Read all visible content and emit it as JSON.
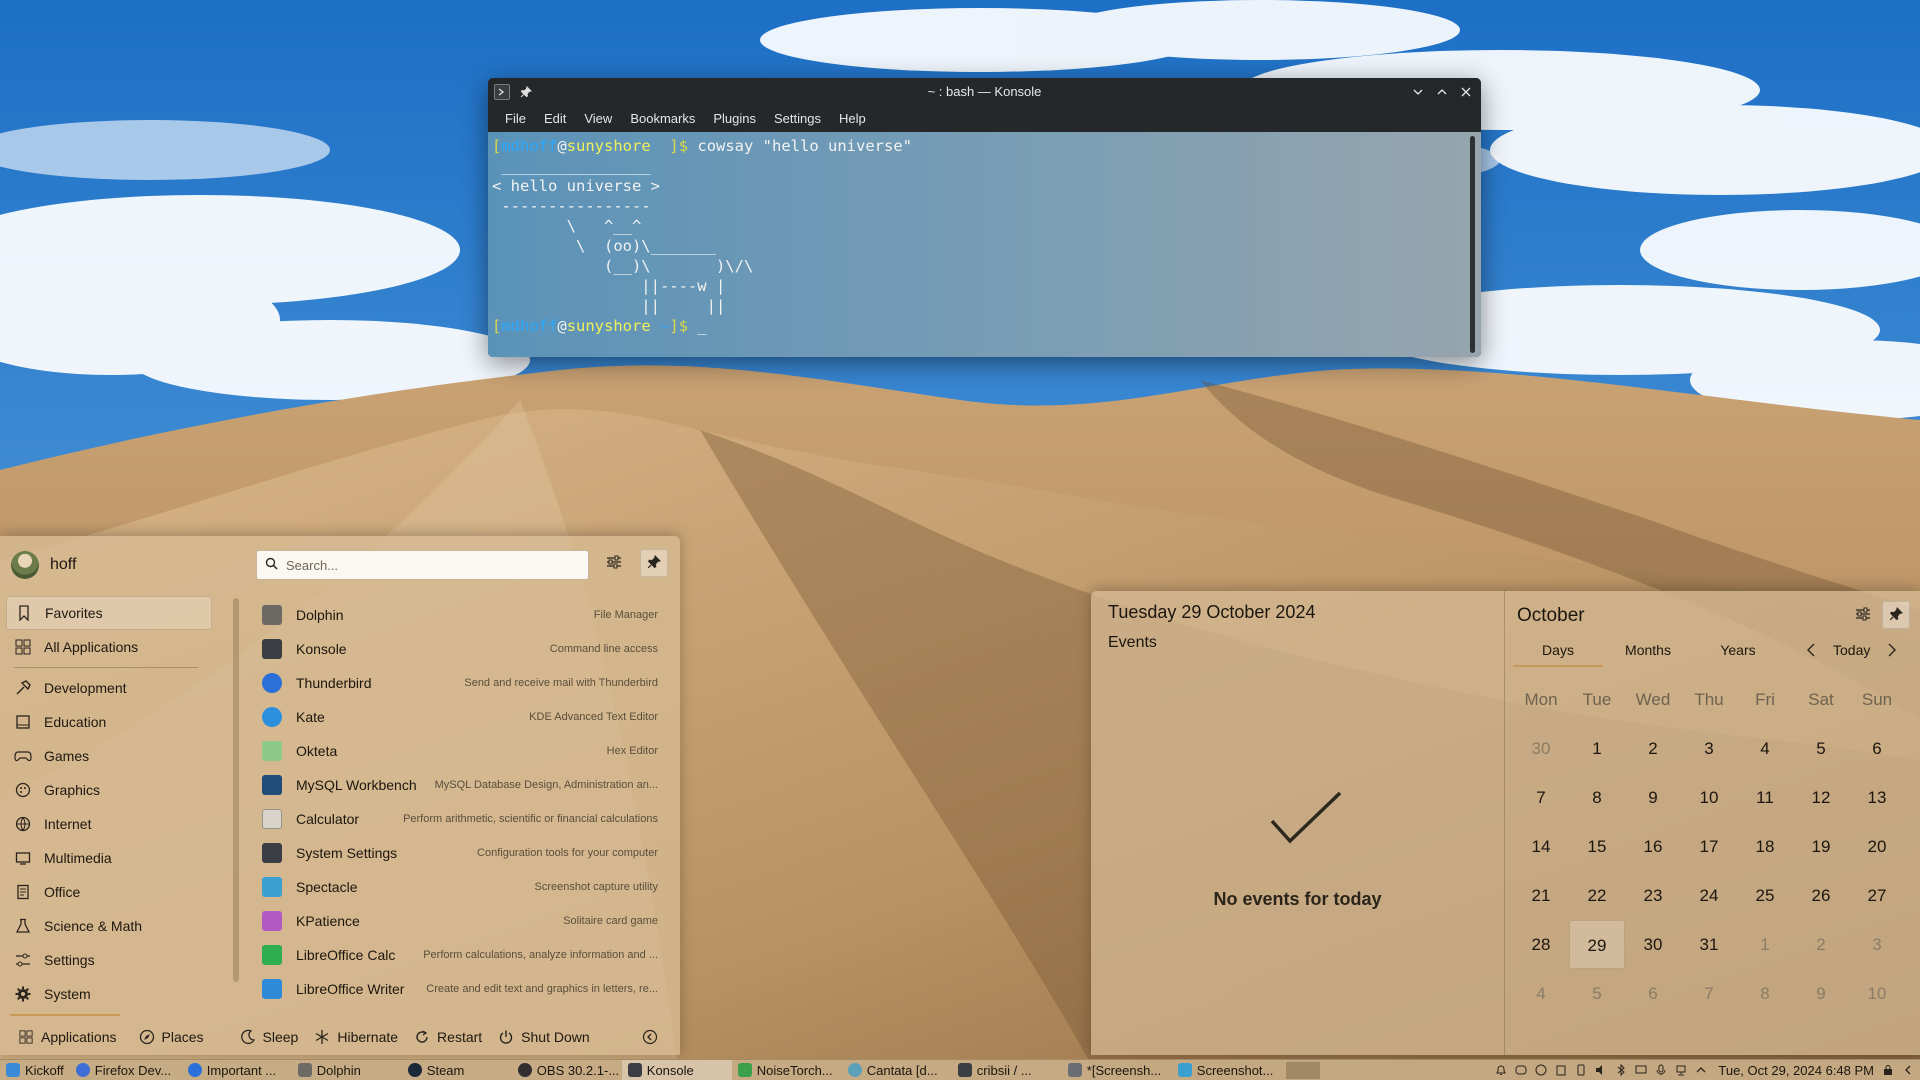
{
  "konsole": {
    "title": "~ : bash — Konsole",
    "menu": [
      "File",
      "Edit",
      "View",
      "Bookmarks",
      "Plugins",
      "Settings",
      "Help"
    ],
    "prompt1": {
      "user": "mdhoff",
      "host": "sunyshore",
      "path": " ",
      "command": "cowsay \"hello universe\""
    },
    "cowsay_output": " ________________\n< hello universe >\n ----------------\n        \\   ^__^\n         \\  (oo)\\_______\n            (__)\\       )\\/\\\n                ||----w |\n                ||     ||",
    "prompt2": {
      "user": "mdhoff",
      "host": "sunyshore",
      "path": "~",
      "cursor": "_"
    }
  },
  "kickoff": {
    "username": "hoff",
    "search_placeholder": "Search...",
    "categories": [
      {
        "label": "Favorites",
        "icon": "bookmark-icon"
      },
      {
        "label": "All Applications",
        "icon": "grid-icon"
      },
      {
        "label": "Development",
        "icon": "hammer-icon"
      },
      {
        "label": "Education",
        "icon": "education-icon"
      },
      {
        "label": "Games",
        "icon": "gamepad-icon"
      },
      {
        "label": "Graphics",
        "icon": "palette-icon"
      },
      {
        "label": "Internet",
        "icon": "globe-icon"
      },
      {
        "label": "Multimedia",
        "icon": "multimedia-icon"
      },
      {
        "label": "Office",
        "icon": "office-icon"
      },
      {
        "label": "Science & Math",
        "icon": "flask-icon"
      },
      {
        "label": "Settings",
        "icon": "sliders-icon"
      },
      {
        "label": "System",
        "icon": "gear-icon"
      }
    ],
    "apps": [
      {
        "name": "Dolphin",
        "desc": "File Manager",
        "color": "#6d6a66"
      },
      {
        "name": "Konsole",
        "desc": "Command line access",
        "color": "#3a3d42"
      },
      {
        "name": "Thunderbird",
        "desc": "Send and receive mail with Thunderbird",
        "color": "#2b6fd8"
      },
      {
        "name": "Kate",
        "desc": "KDE Advanced Text Editor",
        "color": "#2b8fe0"
      },
      {
        "name": "Okteta",
        "desc": "Hex Editor",
        "color": "#8fc98a"
      },
      {
        "name": "MySQL Workbench",
        "desc": "MySQL Database Design, Administration an...",
        "color": "#1e4d7a"
      },
      {
        "name": "Calculator",
        "desc": "Perform arithmetic, scientific or financial calculations",
        "color": "#d8d4cc"
      },
      {
        "name": "System Settings",
        "desc": "Configuration tools for your computer",
        "color": "#3b3f45"
      },
      {
        "name": "Spectacle",
        "desc": "Screenshot capture utility",
        "color": "#3aa0d0"
      },
      {
        "name": "KPatience",
        "desc": "Solitaire card game",
        "color": "#b25ac4"
      },
      {
        "name": "LibreOffice Calc",
        "desc": "Perform calculations, analyze information and ...",
        "color": "#2fae4f"
      },
      {
        "name": "LibreOffice Writer",
        "desc": "Create and edit text and graphics in letters, re...",
        "color": "#2f8bd8"
      }
    ],
    "footer": {
      "applications": "Applications",
      "places": "Places",
      "sleep": "Sleep",
      "hibernate": "Hibernate",
      "restart": "Restart",
      "shutdown": "Shut Down"
    }
  },
  "calendar": {
    "full_date": "Tuesday 29 October 2024",
    "events_heading": "Events",
    "no_events": "No events for today",
    "month": "October",
    "tabs": [
      "Days",
      "Months",
      "Years"
    ],
    "today_label": "Today",
    "weekdays": [
      "Mon",
      "Tue",
      "Wed",
      "Thu",
      "Fri",
      "Sat",
      "Sun"
    ],
    "weeks": [
      [
        "30",
        "1",
        "2",
        "3",
        "4",
        "5",
        "6"
      ],
      [
        "7",
        "8",
        "9",
        "10",
        "11",
        "12",
        "13"
      ],
      [
        "14",
        "15",
        "16",
        "17",
        "18",
        "19",
        "20"
      ],
      [
        "21",
        "22",
        "23",
        "24",
        "25",
        "26",
        "27"
      ],
      [
        "28",
        "29",
        "30",
        "31",
        "1",
        "2",
        "3"
      ],
      [
        "4",
        "5",
        "6",
        "7",
        "8",
        "9",
        "10"
      ]
    ],
    "today": "29"
  },
  "taskbar": {
    "tasks": [
      {
        "label": "Kickoff",
        "color": "#3a8ad8"
      },
      {
        "label": "Firefox Dev...",
        "color": "#3f6fd6"
      },
      {
        "label": "Important ...",
        "color": "#2b6fd8"
      },
      {
        "label": "Dolphin",
        "color": "#6d6a66"
      },
      {
        "label": "Steam",
        "color": "#1b2838"
      },
      {
        "label": "OBS 30.2.1-...",
        "color": "#302e31"
      },
      {
        "label": "Konsole",
        "color": "#3a3d42"
      },
      {
        "label": "NoiseTorch...",
        "color": "#3aa04a"
      },
      {
        "label": "Cantata [d...",
        "color": "#5aa0b8"
      },
      {
        "label": "cribsii / ...",
        "color": "#3a3d42"
      },
      {
        "label": "*[Screensh...",
        "color": "#6a6e74"
      },
      {
        "label": "Screenshot...",
        "color": "#3aa0d0"
      }
    ],
    "clock": "Tue,  Oct 29, 2024 6:48 PM"
  }
}
